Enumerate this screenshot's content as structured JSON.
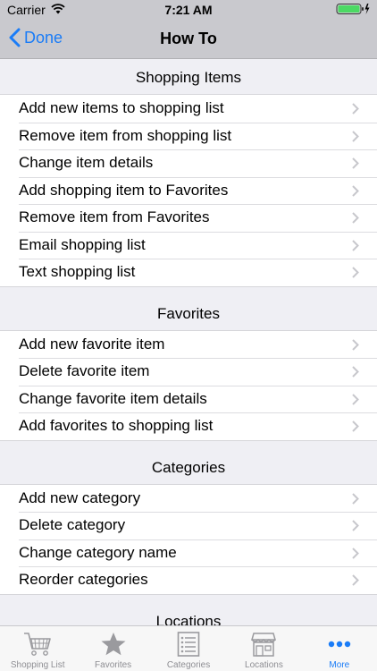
{
  "status": {
    "carrier": "Carrier",
    "time": "7:21 AM"
  },
  "nav": {
    "back_label": "Done",
    "title": "How To"
  },
  "sections": [
    {
      "title": "Shopping Items",
      "items": [
        "Add new items to shopping list",
        "Remove item from shopping list",
        "Change item details",
        "Add shopping item to Favorites",
        "Remove item from Favorites",
        "Email shopping list",
        "Text shopping list"
      ]
    },
    {
      "title": "Favorites",
      "items": [
        "Add new favorite item",
        "Delete favorite item",
        "Change favorite item details",
        "Add favorites to shopping list"
      ]
    },
    {
      "title": "Categories",
      "items": [
        "Add new category",
        "Delete category",
        "Change category name",
        "Reorder categories"
      ]
    },
    {
      "title": "Locations",
      "items": []
    }
  ],
  "tabs": [
    {
      "label": "Shopping List",
      "icon": "cart-icon",
      "active": false
    },
    {
      "label": "Favorites",
      "icon": "star-icon",
      "active": false
    },
    {
      "label": "Categories",
      "icon": "list-icon",
      "active": false
    },
    {
      "label": "Locations",
      "icon": "store-icon",
      "active": false
    },
    {
      "label": "More",
      "icon": "more-icon",
      "active": true
    }
  ],
  "colors": {
    "accent": "#1a7cf7",
    "bar": "#c9c9ce",
    "inactive": "#8e8e93"
  }
}
